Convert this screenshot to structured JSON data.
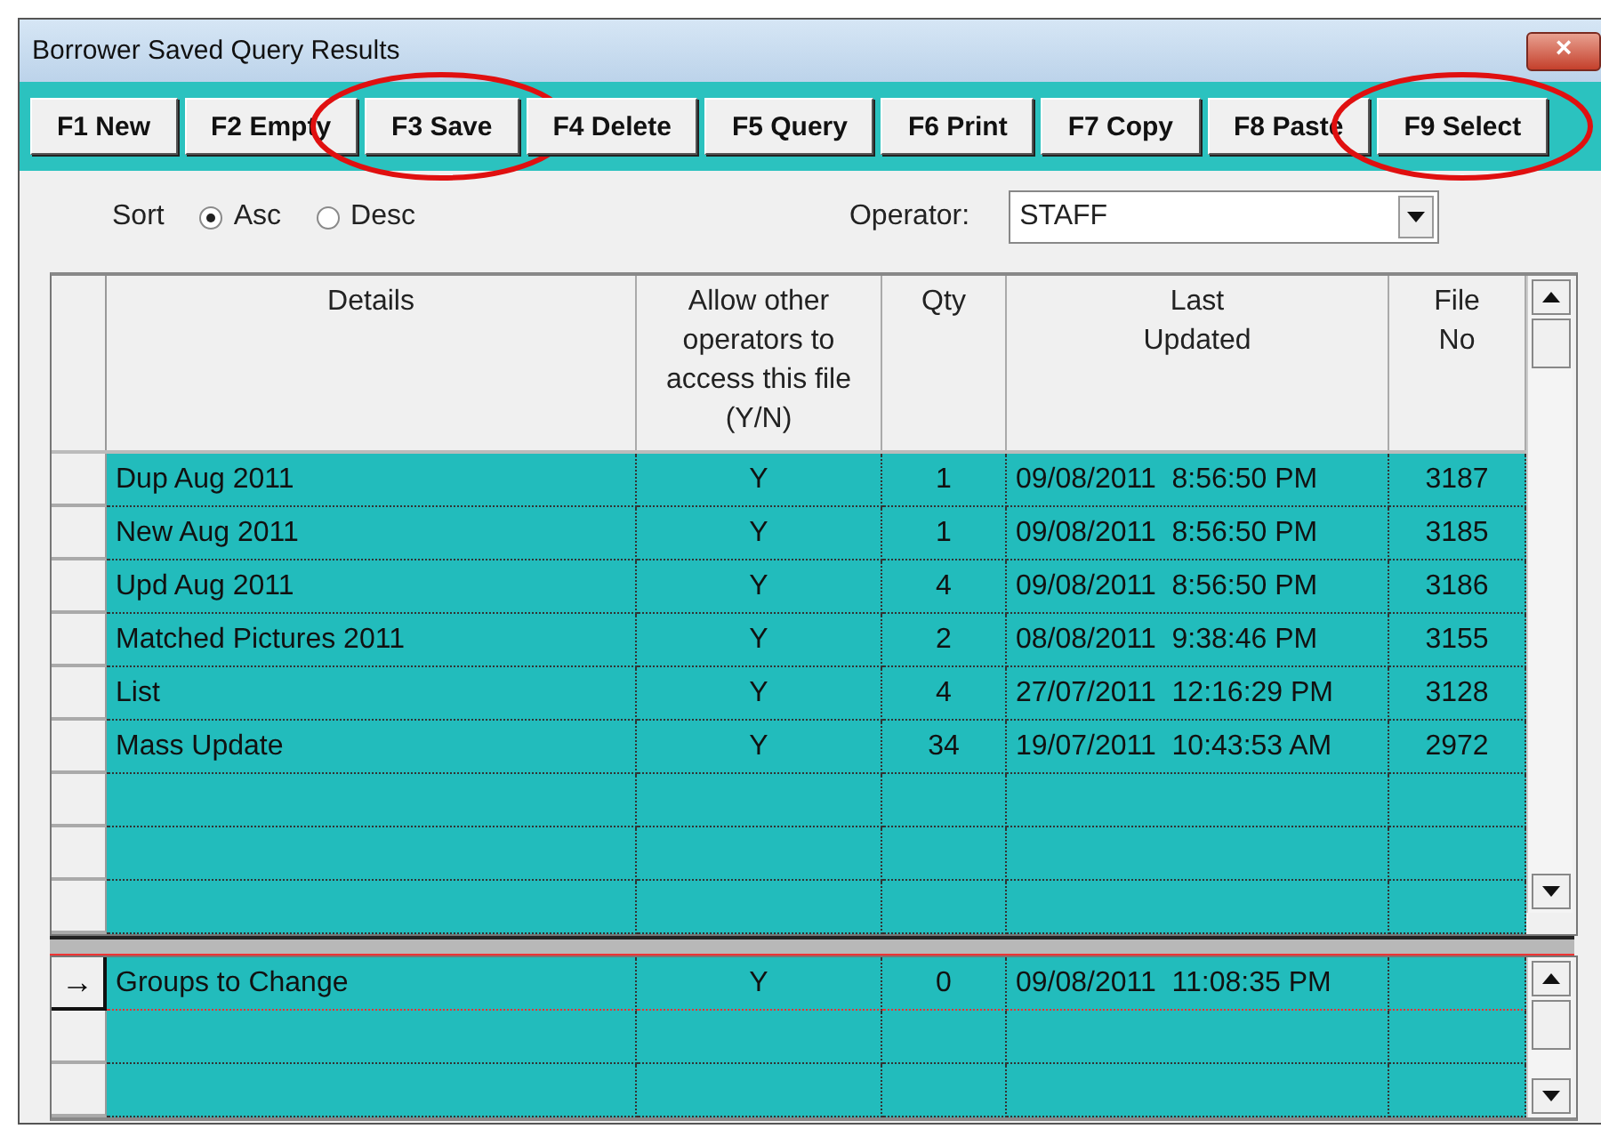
{
  "window": {
    "title": "Borrower Saved Query Results",
    "close": "×"
  },
  "toolbar": [
    {
      "label": "F1 New",
      "circled": false
    },
    {
      "label": "F2 Empty",
      "circled": false
    },
    {
      "label": "F3 Save",
      "circled": true
    },
    {
      "label": "F4 Delete",
      "circled": false
    },
    {
      "label": "F5 Query",
      "circled": false
    },
    {
      "label": "F6 Print",
      "circled": false
    },
    {
      "label": "F7 Copy",
      "circled": false
    },
    {
      "label": "F8 Paste",
      "circled": false
    },
    {
      "label": "F9 Select",
      "circled": true
    }
  ],
  "sort": {
    "label": "Sort",
    "options": [
      {
        "label": "Asc",
        "selected": true
      },
      {
        "label": "Desc",
        "selected": false
      }
    ]
  },
  "operator": {
    "label": "Operator:",
    "value": "STAFF"
  },
  "table": {
    "columns": [
      "Details",
      "Allow other\noperators to\naccess this file\n(Y/N)",
      "Qty",
      "Last\nUpdated",
      "File\nNo"
    ],
    "rows": [
      {
        "current": false,
        "cells": [
          "Dup Aug 2011",
          "Y",
          "1",
          "09/08/2011  8:56:50 PM",
          "3187"
        ]
      },
      {
        "current": false,
        "cells": [
          "New Aug 2011",
          "Y",
          "1",
          "09/08/2011  8:56:50 PM",
          "3185"
        ]
      },
      {
        "current": false,
        "cells": [
          "Upd Aug 2011",
          "Y",
          "4",
          "09/08/2011  8:56:50 PM",
          "3186"
        ]
      },
      {
        "current": false,
        "cells": [
          "Matched Pictures 2011",
          "Y",
          "2",
          "08/08/2011  9:38:46 PM",
          "3155"
        ]
      },
      {
        "current": false,
        "cells": [
          "List",
          "Y",
          "4",
          "27/07/2011  12:16:29 PM",
          "3128"
        ]
      },
      {
        "current": false,
        "cells": [
          "Mass Update",
          "Y",
          "34",
          "19/07/2011  10:43:53 AM",
          "2972"
        ]
      }
    ]
  },
  "new_entry": {
    "rows": [
      {
        "current": true,
        "marker": "→",
        "cells": [
          "Groups to Change",
          "Y",
          "0",
          "09/08/2011  11:08:35 PM"
        ]
      }
    ]
  }
}
